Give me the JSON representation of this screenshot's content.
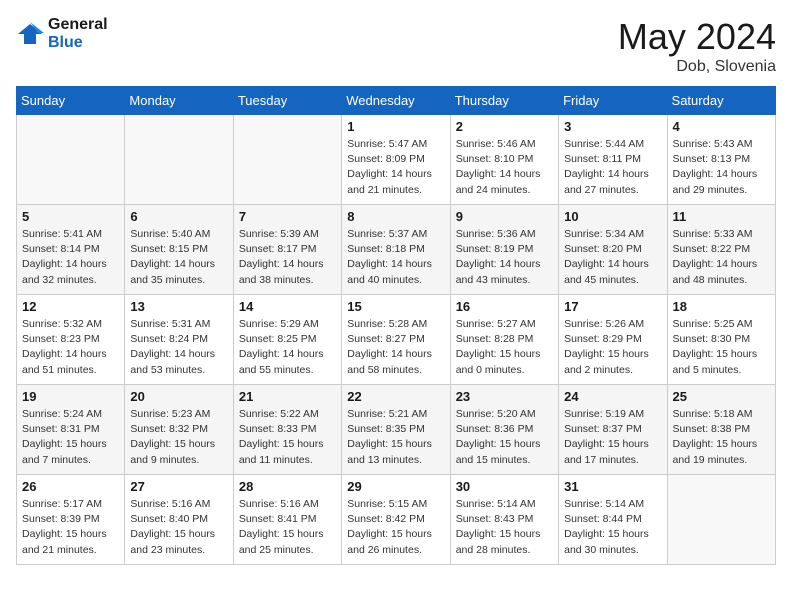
{
  "header": {
    "logo_line1": "General",
    "logo_line2": "Blue",
    "month": "May 2024",
    "location": "Dob, Slovenia"
  },
  "weekdays": [
    "Sunday",
    "Monday",
    "Tuesday",
    "Wednesday",
    "Thursday",
    "Friday",
    "Saturday"
  ],
  "weeks": [
    [
      {
        "day": "",
        "info": ""
      },
      {
        "day": "",
        "info": ""
      },
      {
        "day": "",
        "info": ""
      },
      {
        "day": "1",
        "info": "Sunrise: 5:47 AM\nSunset: 8:09 PM\nDaylight: 14 hours\nand 21 minutes."
      },
      {
        "day": "2",
        "info": "Sunrise: 5:46 AM\nSunset: 8:10 PM\nDaylight: 14 hours\nand 24 minutes."
      },
      {
        "day": "3",
        "info": "Sunrise: 5:44 AM\nSunset: 8:11 PM\nDaylight: 14 hours\nand 27 minutes."
      },
      {
        "day": "4",
        "info": "Sunrise: 5:43 AM\nSunset: 8:13 PM\nDaylight: 14 hours\nand 29 minutes."
      }
    ],
    [
      {
        "day": "5",
        "info": "Sunrise: 5:41 AM\nSunset: 8:14 PM\nDaylight: 14 hours\nand 32 minutes."
      },
      {
        "day": "6",
        "info": "Sunrise: 5:40 AM\nSunset: 8:15 PM\nDaylight: 14 hours\nand 35 minutes."
      },
      {
        "day": "7",
        "info": "Sunrise: 5:39 AM\nSunset: 8:17 PM\nDaylight: 14 hours\nand 38 minutes."
      },
      {
        "day": "8",
        "info": "Sunrise: 5:37 AM\nSunset: 8:18 PM\nDaylight: 14 hours\nand 40 minutes."
      },
      {
        "day": "9",
        "info": "Sunrise: 5:36 AM\nSunset: 8:19 PM\nDaylight: 14 hours\nand 43 minutes."
      },
      {
        "day": "10",
        "info": "Sunrise: 5:34 AM\nSunset: 8:20 PM\nDaylight: 14 hours\nand 45 minutes."
      },
      {
        "day": "11",
        "info": "Sunrise: 5:33 AM\nSunset: 8:22 PM\nDaylight: 14 hours\nand 48 minutes."
      }
    ],
    [
      {
        "day": "12",
        "info": "Sunrise: 5:32 AM\nSunset: 8:23 PM\nDaylight: 14 hours\nand 51 minutes."
      },
      {
        "day": "13",
        "info": "Sunrise: 5:31 AM\nSunset: 8:24 PM\nDaylight: 14 hours\nand 53 minutes."
      },
      {
        "day": "14",
        "info": "Sunrise: 5:29 AM\nSunset: 8:25 PM\nDaylight: 14 hours\nand 55 minutes."
      },
      {
        "day": "15",
        "info": "Sunrise: 5:28 AM\nSunset: 8:27 PM\nDaylight: 14 hours\nand 58 minutes."
      },
      {
        "day": "16",
        "info": "Sunrise: 5:27 AM\nSunset: 8:28 PM\nDaylight: 15 hours\nand 0 minutes."
      },
      {
        "day": "17",
        "info": "Sunrise: 5:26 AM\nSunset: 8:29 PM\nDaylight: 15 hours\nand 2 minutes."
      },
      {
        "day": "18",
        "info": "Sunrise: 5:25 AM\nSunset: 8:30 PM\nDaylight: 15 hours\nand 5 minutes."
      }
    ],
    [
      {
        "day": "19",
        "info": "Sunrise: 5:24 AM\nSunset: 8:31 PM\nDaylight: 15 hours\nand 7 minutes."
      },
      {
        "day": "20",
        "info": "Sunrise: 5:23 AM\nSunset: 8:32 PM\nDaylight: 15 hours\nand 9 minutes."
      },
      {
        "day": "21",
        "info": "Sunrise: 5:22 AM\nSunset: 8:33 PM\nDaylight: 15 hours\nand 11 minutes."
      },
      {
        "day": "22",
        "info": "Sunrise: 5:21 AM\nSunset: 8:35 PM\nDaylight: 15 hours\nand 13 minutes."
      },
      {
        "day": "23",
        "info": "Sunrise: 5:20 AM\nSunset: 8:36 PM\nDaylight: 15 hours\nand 15 minutes."
      },
      {
        "day": "24",
        "info": "Sunrise: 5:19 AM\nSunset: 8:37 PM\nDaylight: 15 hours\nand 17 minutes."
      },
      {
        "day": "25",
        "info": "Sunrise: 5:18 AM\nSunset: 8:38 PM\nDaylight: 15 hours\nand 19 minutes."
      }
    ],
    [
      {
        "day": "26",
        "info": "Sunrise: 5:17 AM\nSunset: 8:39 PM\nDaylight: 15 hours\nand 21 minutes."
      },
      {
        "day": "27",
        "info": "Sunrise: 5:16 AM\nSunset: 8:40 PM\nDaylight: 15 hours\nand 23 minutes."
      },
      {
        "day": "28",
        "info": "Sunrise: 5:16 AM\nSunset: 8:41 PM\nDaylight: 15 hours\nand 25 minutes."
      },
      {
        "day": "29",
        "info": "Sunrise: 5:15 AM\nSunset: 8:42 PM\nDaylight: 15 hours\nand 26 minutes."
      },
      {
        "day": "30",
        "info": "Sunrise: 5:14 AM\nSunset: 8:43 PM\nDaylight: 15 hours\nand 28 minutes."
      },
      {
        "day": "31",
        "info": "Sunrise: 5:14 AM\nSunset: 8:44 PM\nDaylight: 15 hours\nand 30 minutes."
      },
      {
        "day": "",
        "info": ""
      }
    ]
  ]
}
